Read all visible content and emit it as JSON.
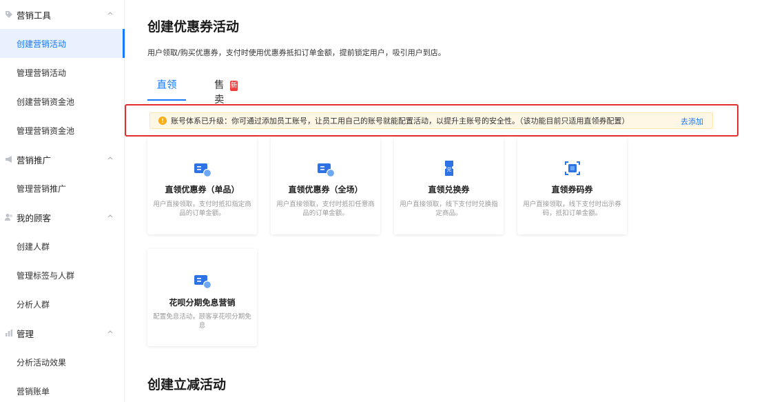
{
  "sidebar": {
    "groups": [
      {
        "label": "营销工具",
        "icon": "tag-icon"
      },
      {
        "label": "营销推广",
        "icon": "megaphone-icon"
      },
      {
        "label": "我的顾客",
        "icon": "users-icon"
      },
      {
        "label": "管理",
        "icon": "bar-chart-icon"
      }
    ],
    "items": [
      {
        "label": "创建营销活动",
        "active": true
      },
      {
        "label": "管理营销活动"
      },
      {
        "label": "创建营销资金池"
      },
      {
        "label": "管理营销资金池"
      },
      {
        "label": "管理营销推广"
      },
      {
        "label": "创建人群"
      },
      {
        "label": "管理标签与人群"
      },
      {
        "label": "分析人群"
      },
      {
        "label": "分析活动效果"
      },
      {
        "label": "营销账单"
      }
    ]
  },
  "main": {
    "title": "创建优惠券活动",
    "description": "用户领取/购买优惠券，支付时使用优惠券抵扣订单金额，提前锁定用户，吸引用户到店。",
    "tabs": [
      {
        "label": "直领",
        "active": true
      },
      {
        "label": "售卖",
        "badge": "新"
      }
    ],
    "notice": {
      "text": "账号体系已升级：你可通过添加员工账号，让员工用自己的账号就能配置活动，以提升主账号的安全性。（该功能目前只适用直领券配置）",
      "link": "去添加"
    },
    "cards": [
      {
        "title": "直领优惠券（单品）",
        "desc": "用户直接领取，支付时抵扣指定商品的订单金额。",
        "icon": "coupon-icon"
      },
      {
        "title": "直领优惠券（全场）",
        "desc": "用户直接领取，支付时抵扣任意商品的订单金额。",
        "icon": "coupon-icon"
      },
      {
        "title": "直领兑换券",
        "desc": "用户直接领取，线下支付时兑换指定商品。",
        "icon": "exchange-ticket-icon"
      },
      {
        "title": "直领券码券",
        "desc": "用户直接领取，线下支付时出示券码，抵扣订单金额。",
        "icon": "scan-code-icon"
      },
      {
        "title": "花呗分期免息营销",
        "desc": "配置免息活动，顾客享花呗分期免息",
        "icon": "coupon-icon"
      }
    ],
    "section2_title": "创建立减活动"
  },
  "colors": {
    "accent": "#1677ff",
    "highlight_border": "#e52d2d",
    "notice_bg": "#fff7e6",
    "badge_red": "#f23d3d"
  }
}
